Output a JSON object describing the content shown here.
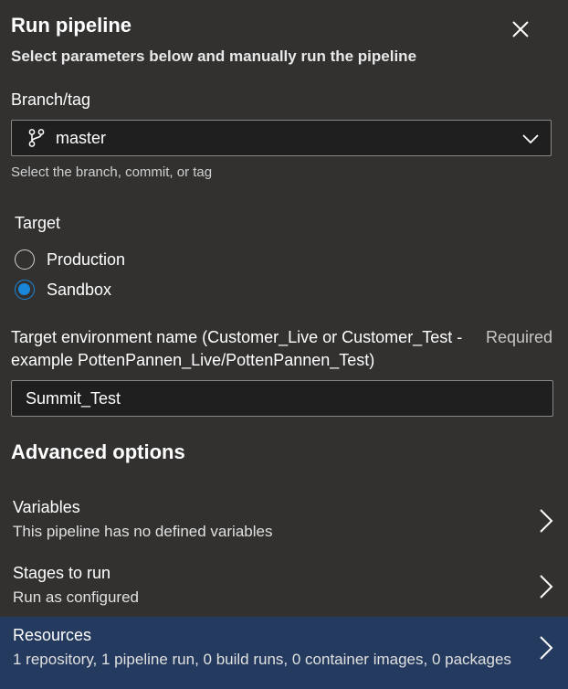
{
  "header": {
    "title": "Run pipeline",
    "subtitle": "Select parameters below and manually run the pipeline",
    "close_icon": "close-icon"
  },
  "branch": {
    "label": "Branch/tag",
    "value": "master",
    "icon": "branch-icon",
    "help": "Select the branch, commit, or tag"
  },
  "target": {
    "label": "Target",
    "options": [
      {
        "label": "Production",
        "checked": false
      },
      {
        "label": "Sandbox",
        "checked": true
      }
    ]
  },
  "environment": {
    "label": "Target environment name (Customer_Live or Customer_Test - example PottenPannen_Live/PottenPannen_Test)",
    "required": "Required",
    "value": "Summit_Test"
  },
  "advanced": {
    "heading": "Advanced options",
    "items": [
      {
        "title": "Variables",
        "subtitle": "This pipeline has no defined variables",
        "selected": false
      },
      {
        "title": "Stages to run",
        "subtitle": "Run as configured",
        "selected": false
      },
      {
        "title": "Resources",
        "subtitle": "1 repository, 1 pipeline run, 0 build runs, 0 container images, 0 packages",
        "selected": true
      }
    ]
  },
  "colors": {
    "background": "#323130",
    "input_background": "#1f1f1f",
    "accent": "#1a86d9",
    "selected_row": "#243a5e"
  }
}
